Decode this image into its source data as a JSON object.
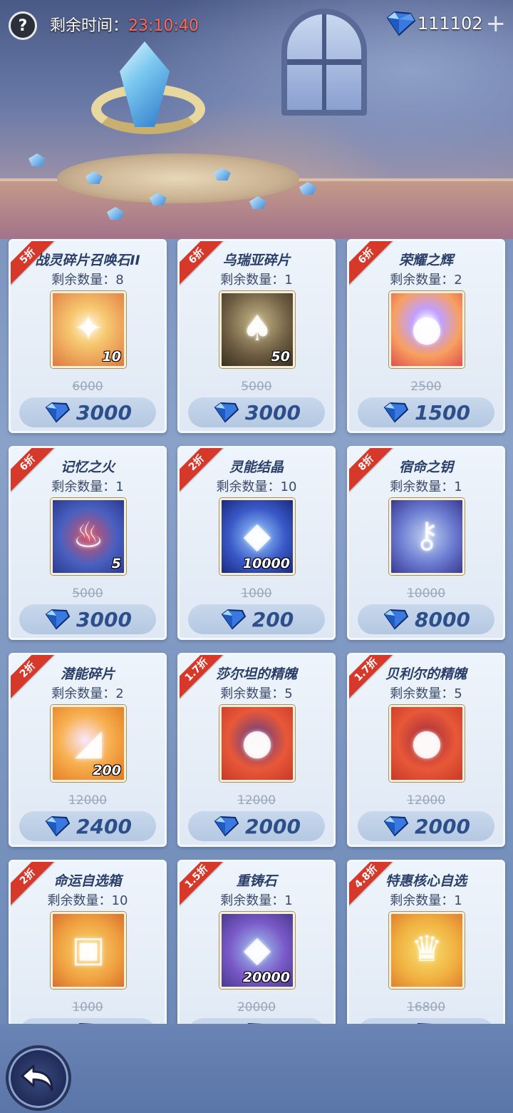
{
  "header": {
    "help_label": "?",
    "timer_label": "剩余时间：",
    "timer_value": "23:10:40",
    "currency_amount": "111102",
    "currency_icon": "diamond-icon",
    "add_label": "+"
  },
  "items": [
    {
      "tag": "5折",
      "name": "战灵碎片召唤石II",
      "remain": "剩余数量：8",
      "qty": "10",
      "orig": "6000",
      "price": "3000",
      "art": "art-gold",
      "glyph": "✦"
    },
    {
      "tag": "6折",
      "name": "乌瑞亚碎片",
      "remain": "剩余数量：1",
      "qty": "50",
      "orig": "5000",
      "price": "3000",
      "art": "art-wood",
      "glyph": "♠"
    },
    {
      "tag": "6折",
      "name": "荣耀之辉",
      "remain": "剩余数量：2",
      "qty": "",
      "orig": "2500",
      "price": "1500",
      "art": "art-orb",
      "glyph": "●"
    },
    {
      "tag": "6折",
      "name": "记忆之火",
      "remain": "剩余数量：1",
      "qty": "5",
      "orig": "5000",
      "price": "3000",
      "art": "art-fire",
      "glyph": "♨"
    },
    {
      "tag": "2折",
      "name": "灵能结晶",
      "remain": "剩余数量：10",
      "qty": "10000",
      "orig": "1000",
      "price": "200",
      "art": "art-crystal",
      "glyph": "◆"
    },
    {
      "tag": "8折",
      "name": "宿命之钥",
      "remain": "剩余数量：1",
      "qty": "",
      "orig": "10000",
      "price": "8000",
      "art": "art-key",
      "glyph": "⚷"
    },
    {
      "tag": "2折",
      "name": "潜能碎片",
      "remain": "剩余数量：2",
      "qty": "200",
      "orig": "12000",
      "price": "2400",
      "art": "art-shard",
      "glyph": "◢"
    },
    {
      "tag": "1.7折",
      "name": "莎尔坦的精魄",
      "remain": "剩余数量：5",
      "qty": "",
      "orig": "12000",
      "price": "2000",
      "art": "art-dark",
      "glyph": "●"
    },
    {
      "tag": "1.7折",
      "name": "贝利尔的精魄",
      "remain": "剩余数量：5",
      "qty": "",
      "orig": "12000",
      "price": "2000",
      "art": "art-red",
      "glyph": "●"
    },
    {
      "tag": "2折",
      "name": "命运自选箱",
      "remain": "剩余数量：10",
      "qty": "",
      "orig": "1000",
      "price": "",
      "art": "art-chest",
      "glyph": "▣"
    },
    {
      "tag": "1.5折",
      "name": "重铸石",
      "remain": "剩余数量：1",
      "qty": "20000",
      "orig": "20000",
      "price": "",
      "art": "art-stone",
      "glyph": "◆"
    },
    {
      "tag": "4.8折",
      "name": "特惠核心自选",
      "remain": "剩余数量：1",
      "qty": "",
      "orig": "16800",
      "price": "",
      "art": "art-card",
      "glyph": "♛"
    }
  ],
  "footer": {
    "back_icon": "back-arrow-icon"
  },
  "colors": {
    "tag_red": "#d6382a",
    "price_blue": "#2c4e8a",
    "timer_red": "#ff6a5a"
  }
}
